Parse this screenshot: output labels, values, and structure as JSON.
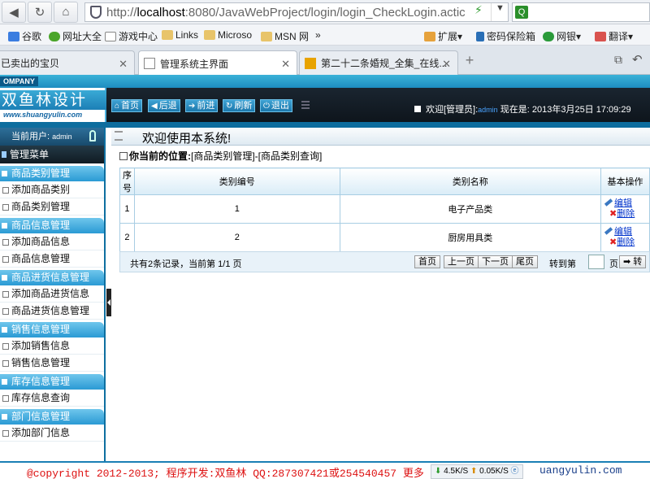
{
  "browser": {
    "url_prefix": "http://",
    "url_host": "localhost",
    "url_rest": ":8080/JavaWebProject/login/login_CheckLogin.actic",
    "search_value": ""
  },
  "bookmarks": [
    {
      "label": "谷歌"
    },
    {
      "label": "网址大全"
    },
    {
      "label": "游戏中心"
    },
    {
      "label": "Links"
    },
    {
      "label": "Microso"
    },
    {
      "label": "MSN 网"
    },
    {
      "label": "»"
    },
    {
      "label": "扩展"
    },
    {
      "label": "密码保险箱"
    },
    {
      "label": "网银"
    },
    {
      "label": "翻译"
    }
  ],
  "tabs": [
    {
      "label": "已卖出的宝贝"
    },
    {
      "label": "管理系统主界面"
    },
    {
      "label": "第二十二条婚规_全集_在线..."
    }
  ],
  "app": {
    "company": "OMPANY",
    "logo_text": "双鱼林设计",
    "logo_sub": "www.shuangyulin.com",
    "top_buttons": [
      {
        "label": "首页",
        "icon": "⌂"
      },
      {
        "label": "后退",
        "icon": "◀"
      },
      {
        "label": "前进",
        "icon": "➔"
      },
      {
        "label": "刷新",
        "icon": "↻"
      },
      {
        "label": "退出",
        "icon": "⏻"
      }
    ],
    "welcome_prefix": "欢迎[管理员]:",
    "welcome_user": "admin",
    "welcome_time": "现在是: 2013年3月25日 17:09:29"
  },
  "sidebar": {
    "current_user_label": "当前用户:",
    "current_user": "admin",
    "menu_title": "管理菜单",
    "groups": [
      {
        "title": "商品类别管理",
        "items": [
          "添加商品类别",
          "商品类别管理"
        ]
      },
      {
        "title": "商品信息管理",
        "items": [
          "添加商品信息",
          "商品信息管理"
        ]
      },
      {
        "title": "商品进货信息管理",
        "items": [
          "添加商品进货信息",
          "商品进货信息管理"
        ]
      },
      {
        "title": "销售信息管理",
        "items": [
          "添加销售信息",
          "销售信息管理"
        ]
      },
      {
        "title": "库存信息管理",
        "items": [
          "库存信息查询"
        ]
      },
      {
        "title": "部门信息管理",
        "items": [
          "添加部门信息"
        ]
      }
    ]
  },
  "main": {
    "welcome": "欢迎使用本系统!",
    "location_label": "你当前的位置:",
    "location_path": "[商品类别管理]-[商品类别查询]",
    "table": {
      "headers": [
        "序号",
        "类别编号",
        "类别名称",
        "基本操作"
      ],
      "rows": [
        {
          "index": "1",
          "code": "1",
          "name": "电子产品类"
        },
        {
          "index": "2",
          "code": "2",
          "name": "厨房用具类"
        }
      ],
      "edit_label": "编辑",
      "delete_label": "删除"
    },
    "pager": {
      "info": "共有2条记录，当前第 1/1 页",
      "first": "首页",
      "prev": "上一页",
      "next": "下一页",
      "last": "尾页",
      "goto_label": "转到第",
      "page_unit": "页",
      "go": "➡ 转",
      "page_input": ""
    }
  },
  "footer": {
    "copyright": "@copyright 2012-2013; 程序开发:双鱼林  QQ:287307421或254540457  更多",
    "site": "uangyulin.com",
    "download": "4.5K/S",
    "upload": "0.05K/S"
  }
}
